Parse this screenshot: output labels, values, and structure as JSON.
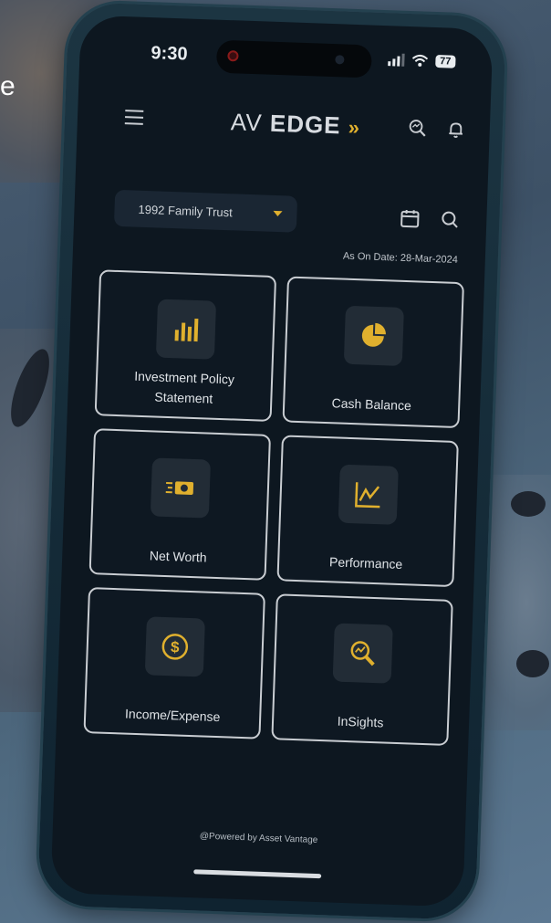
{
  "background": {
    "edge_text": "e"
  },
  "status_bar": {
    "time": "9:30",
    "battery": "77"
  },
  "header": {
    "logo_av": "AV",
    "logo_edge": "EDGE",
    "logo_arrows": "»"
  },
  "filters": {
    "entity": "1992 Family Trust",
    "as_on_date": "As On Date: 28-Mar-2024"
  },
  "tiles": [
    {
      "label": "Investment Policy Statement",
      "icon": "bar-chart-icon"
    },
    {
      "label": "Cash Balance",
      "icon": "pie-chart-icon"
    },
    {
      "label": "Net Worth",
      "icon": "cash-icon"
    },
    {
      "label": "Performance",
      "icon": "line-chart-icon"
    },
    {
      "label": "Income/Expense",
      "icon": "dollar-coin-icon"
    },
    {
      "label": "InSights",
      "icon": "magnify-chart-icon"
    }
  ],
  "footer": {
    "powered_by": "@Powered by Asset Vantage"
  },
  "colors": {
    "accent": "#e0b02e",
    "screen_bg": "#0d1720",
    "tile_border": "#c9cdd2"
  }
}
